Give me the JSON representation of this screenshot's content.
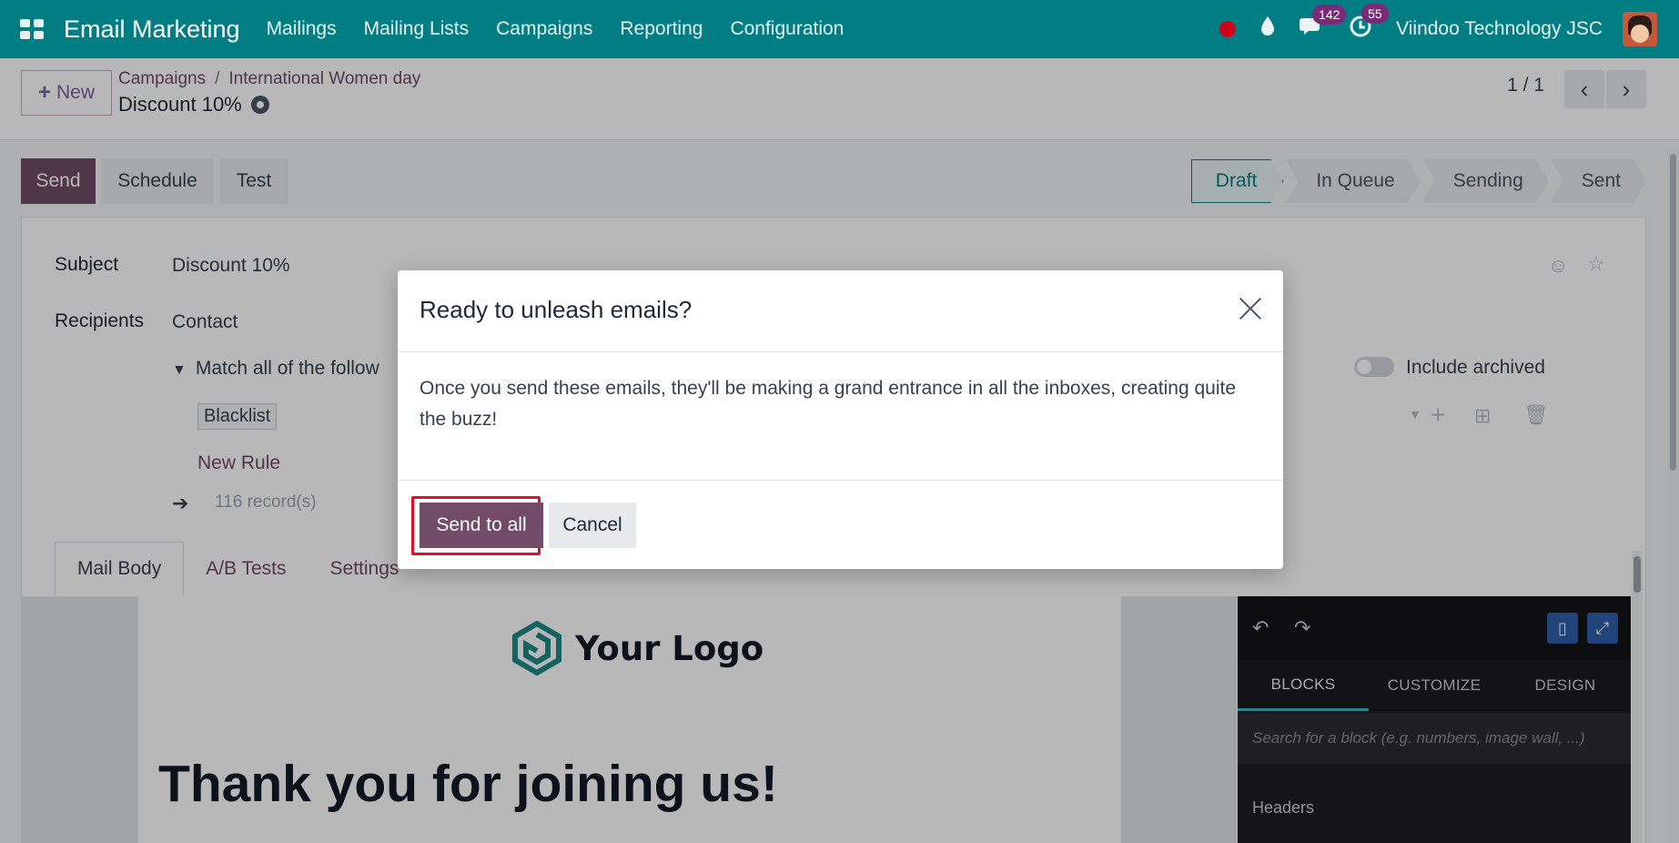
{
  "navbar": {
    "app_title": "Email Marketing",
    "menu": [
      "Mailings",
      "Mailing Lists",
      "Campaigns",
      "Reporting",
      "Configuration"
    ],
    "messages_count": "142",
    "activities_count": "55",
    "company": "Viindoo Technology JSC"
  },
  "control_panel": {
    "new_label": "New",
    "breadcrumb": [
      "Campaigns",
      "International Women day"
    ],
    "breadcrumb_sep": "/",
    "record_title": "Discount 10%",
    "pager": "1 / 1"
  },
  "statusbar": {
    "send_label": "Send",
    "schedule_label": "Schedule",
    "test_label": "Test",
    "stages": [
      "Draft",
      "In Queue",
      "Sending",
      "Sent"
    ],
    "active_stage": "Draft"
  },
  "form": {
    "subject_label": "Subject",
    "subject_value": "Discount 10%",
    "recipients_label": "Recipients",
    "recipients_value": "Contact",
    "match_text": "Match all of the follow",
    "include_archived_label": "Include archived",
    "rule_tag": "Blacklist",
    "new_rule_label": "New Rule",
    "records_count": "116 record(s)",
    "tabs": [
      "Mail Body",
      "A/B Tests",
      "Settings"
    ]
  },
  "editor": {
    "logo_text": "Your Logo",
    "heading": "Thank you for joining us!",
    "builder_tabs": [
      "BLOCKS",
      "CUSTOMIZE",
      "DESIGN"
    ],
    "search_placeholder": "Search for a block (e.g. numbers, image wall, ...)",
    "section_title": "Headers"
  },
  "modal": {
    "title": "Ready to unleash emails?",
    "body": "Once you send these emails, they'll be making a grand entrance in all the inboxes, creating quite the buzz!",
    "confirm_label": "Send to all",
    "cancel_label": "Cancel"
  },
  "colors": {
    "navbar": "#017e84",
    "primary": "#714b67",
    "highlight": "#e0102b"
  }
}
